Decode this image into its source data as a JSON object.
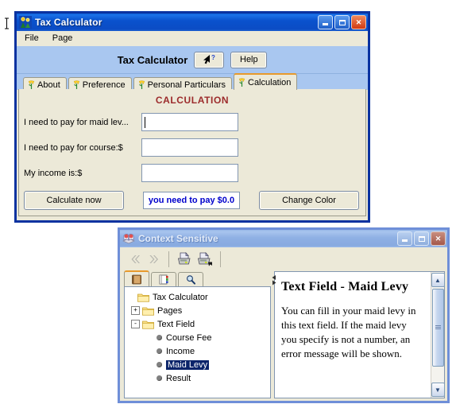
{
  "main_window": {
    "title": "Tax Calculator",
    "icon": "flowers-icon",
    "title_buttons": [
      {
        "name": "minimize-button",
        "glyph": "_"
      },
      {
        "name": "maximize-button",
        "glyph": "□"
      },
      {
        "name": "close-button",
        "glyph": "✕"
      }
    ],
    "menu": [
      "File",
      "Page"
    ],
    "header": {
      "title": "Tax Calculator",
      "context_help_button": "context-help-cursor-icon",
      "help_button": "Help"
    },
    "tabs": [
      {
        "label": "About",
        "active": false
      },
      {
        "label": "Preference",
        "active": false
      },
      {
        "label": "Personal Particulars",
        "active": false
      },
      {
        "label": "Calculation",
        "active": true
      }
    ],
    "panel": {
      "title": "CALCULATION",
      "fields": [
        {
          "label": "I need to pay for maid lev...",
          "value": "",
          "focused": true
        },
        {
          "label": "I need to pay for course:$",
          "value": "",
          "focused": false
        },
        {
          "label": "My income is:$",
          "value": "",
          "focused": false
        }
      ],
      "calculate_button": "Calculate now",
      "result_text": "you need to pay $0.0",
      "result_color": "#0000CC",
      "change_color_button": "Change Color",
      "title_color": "#9C2B2B"
    }
  },
  "help_window": {
    "title": "Context Sensitive",
    "icon": "help-book-icon",
    "title_buttons": [
      {
        "name": "minimize-button",
        "glyph": "_"
      },
      {
        "name": "maximize-button",
        "glyph": "□"
      },
      {
        "name": "close-button",
        "glyph": "✕"
      }
    ],
    "toolbar": [
      {
        "name": "back-button",
        "icon": "chevron-left-icon",
        "enabled": false
      },
      {
        "name": "forward-button",
        "icon": "chevron-right-icon",
        "enabled": false
      },
      {
        "name": "print-button",
        "icon": "printer-icon"
      },
      {
        "name": "page-setup-button",
        "icon": "printer-setup-icon"
      }
    ],
    "nav_tabs": [
      {
        "name": "contents-tab",
        "icon": "book-icon",
        "active": true
      },
      {
        "name": "index-tab",
        "icon": "index-pages-icon",
        "active": false
      },
      {
        "name": "search-tab",
        "icon": "magnifier-icon",
        "active": false
      }
    ],
    "tree": [
      {
        "label": "Tax Calculator",
        "type": "folder",
        "depth": 0,
        "toggle": "",
        "selected": false
      },
      {
        "label": "Pages",
        "type": "folder",
        "depth": 1,
        "toggle": "+",
        "selected": false
      },
      {
        "label": "Text Field",
        "type": "folder",
        "depth": 1,
        "toggle": "-",
        "selected": false
      },
      {
        "label": "Course Fee",
        "type": "leaf",
        "depth": 2,
        "toggle": "",
        "selected": false
      },
      {
        "label": "Income",
        "type": "leaf",
        "depth": 2,
        "toggle": "",
        "selected": false
      },
      {
        "label": "Maid Levy",
        "type": "leaf",
        "depth": 2,
        "toggle": "",
        "selected": true
      },
      {
        "label": "Result",
        "type": "leaf",
        "depth": 2,
        "toggle": "",
        "selected": false
      }
    ],
    "document": {
      "heading": "Text Field - Maid Levy",
      "body": "You can fill in your maid levy in this text field. If the maid levy you specify is not a number, an error message will be shown."
    }
  }
}
